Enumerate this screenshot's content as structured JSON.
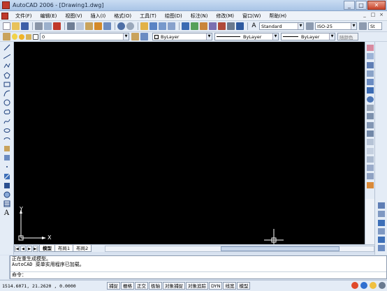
{
  "window": {
    "title": "AutoCAD 2006 - [Drawing1.dwg]",
    "minimize": "_",
    "maximize": "□",
    "close": "✕"
  },
  "menu": {
    "items": [
      "文件(F)",
      "编辑(E)",
      "视图(V)",
      "插入(I)",
      "格式(O)",
      "工具(T)",
      "绘图(D)",
      "标注(N)",
      "修改(M)",
      "窗口(W)",
      "帮助(H)"
    ],
    "doc_min": "_",
    "doc_max": "□",
    "doc_close": "×"
  },
  "toolbar": {
    "text_style": "Standard",
    "dim_style": "ISO-25",
    "table_style": "St"
  },
  "layers_toolbar": {
    "layer": "0",
    "color": "ByLayer",
    "linetype": "ByLayer",
    "lineweight": "ByLayer",
    "plot_style": "随颜色"
  },
  "tabs": {
    "nav": [
      "|◀",
      "◀",
      "▶",
      "▶|"
    ],
    "items": [
      "模型",
      "布局1",
      "布局2"
    ]
  },
  "ucs": {
    "x_label": "X",
    "y_label": "Y"
  },
  "command": {
    "lines": [
      "正在重生成模型。",
      "AutoCAD 菜单实用程序已加载。"
    ],
    "prompt": "命令："
  },
  "status": {
    "coords": "1514.6071, 21.2620 , 0.0000",
    "buttons": [
      "捕捉",
      "栅格",
      "正交",
      "极轴",
      "对象捕捉",
      "对象追踪",
      "DYN",
      "线宽",
      "模型"
    ]
  },
  "colors": {
    "canvas": "#000000",
    "window_chrome": "#d8e2f0",
    "accent_red": "#c0392b"
  }
}
